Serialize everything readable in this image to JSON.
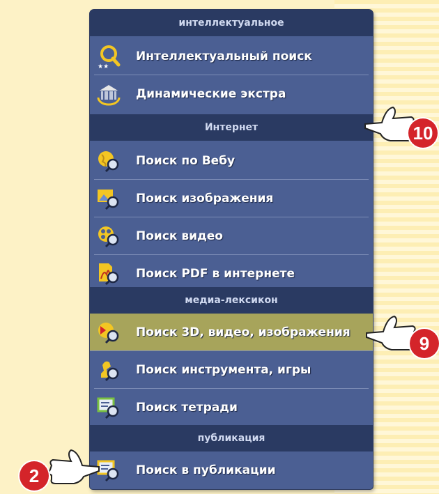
{
  "sections": {
    "intellectual": {
      "header": "интеллектуальное",
      "items": [
        {
          "label": "Интеллектуальный поиск",
          "icon": "smart-search-icon"
        },
        {
          "label": "Динамические экстра",
          "icon": "dynamic-extras-icon"
        }
      ]
    },
    "internet": {
      "header": "Интернет",
      "items": [
        {
          "label": "Поиск по Вебу",
          "icon": "web-search-icon"
        },
        {
          "label": "Поиск изображения",
          "icon": "image-search-icon"
        },
        {
          "label": "Поиск видео",
          "icon": "video-search-icon"
        },
        {
          "label": "Поиск PDF в интернете",
          "icon": "pdf-search-icon"
        }
      ]
    },
    "media": {
      "header": "медиа-лексикон",
      "items": [
        {
          "label": "Поиск 3D, видео, изображения",
          "icon": "3d-media-search-icon"
        },
        {
          "label": "Поиск инструмента, игры",
          "icon": "tool-game-search-icon"
        },
        {
          "label": "Поиск тетради",
          "icon": "notebook-search-icon"
        }
      ]
    },
    "publication": {
      "header": "публикация",
      "items": [
        {
          "label": "Поиск в публикации",
          "icon": "publication-search-icon"
        }
      ]
    }
  },
  "callouts": [
    {
      "number": "10"
    },
    {
      "number": "9"
    },
    {
      "number": "2"
    }
  ],
  "colors": {
    "panel": "#4b5f93",
    "header": "#2a3a62",
    "highlight": "#a7a45b",
    "badge": "#d4242a"
  }
}
